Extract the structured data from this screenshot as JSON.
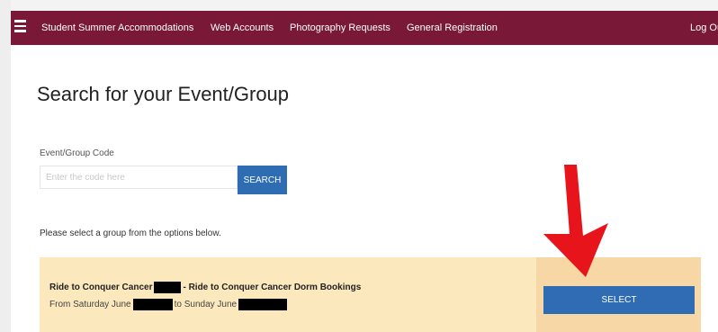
{
  "nav": {
    "items": [
      {
        "label": "Student Summer Accommodations"
      },
      {
        "label": "Web Accounts"
      },
      {
        "label": "Photography Requests"
      },
      {
        "label": "General Registration"
      }
    ],
    "logout_label": "Log Ou"
  },
  "main": {
    "title": "Search for your Event/Group",
    "code_field": {
      "label": "Event/Group Code",
      "placeholder": "Enter the code here",
      "value": ""
    },
    "search_button": "SEARCH",
    "instructions": "Please select a group from the options below."
  },
  "group": {
    "title_prefix": "Ride to Conquer Cancer",
    "title_suffix": "- Ride to Conquer Cancer Dorm Bookings",
    "dates_prefix": "From Saturday June",
    "dates_middle": "to Sunday June",
    "select_label": "SELECT"
  },
  "colors": {
    "topbar": "#7a1838",
    "primary_button": "#2e6db1",
    "group_row": "#fbe8bc",
    "group_action": "#f6d7a5",
    "annotation_arrow": "#e8141b"
  },
  "icons": {
    "menu": "hamburger-menu-icon",
    "annotation": "down-arrow-icon"
  }
}
